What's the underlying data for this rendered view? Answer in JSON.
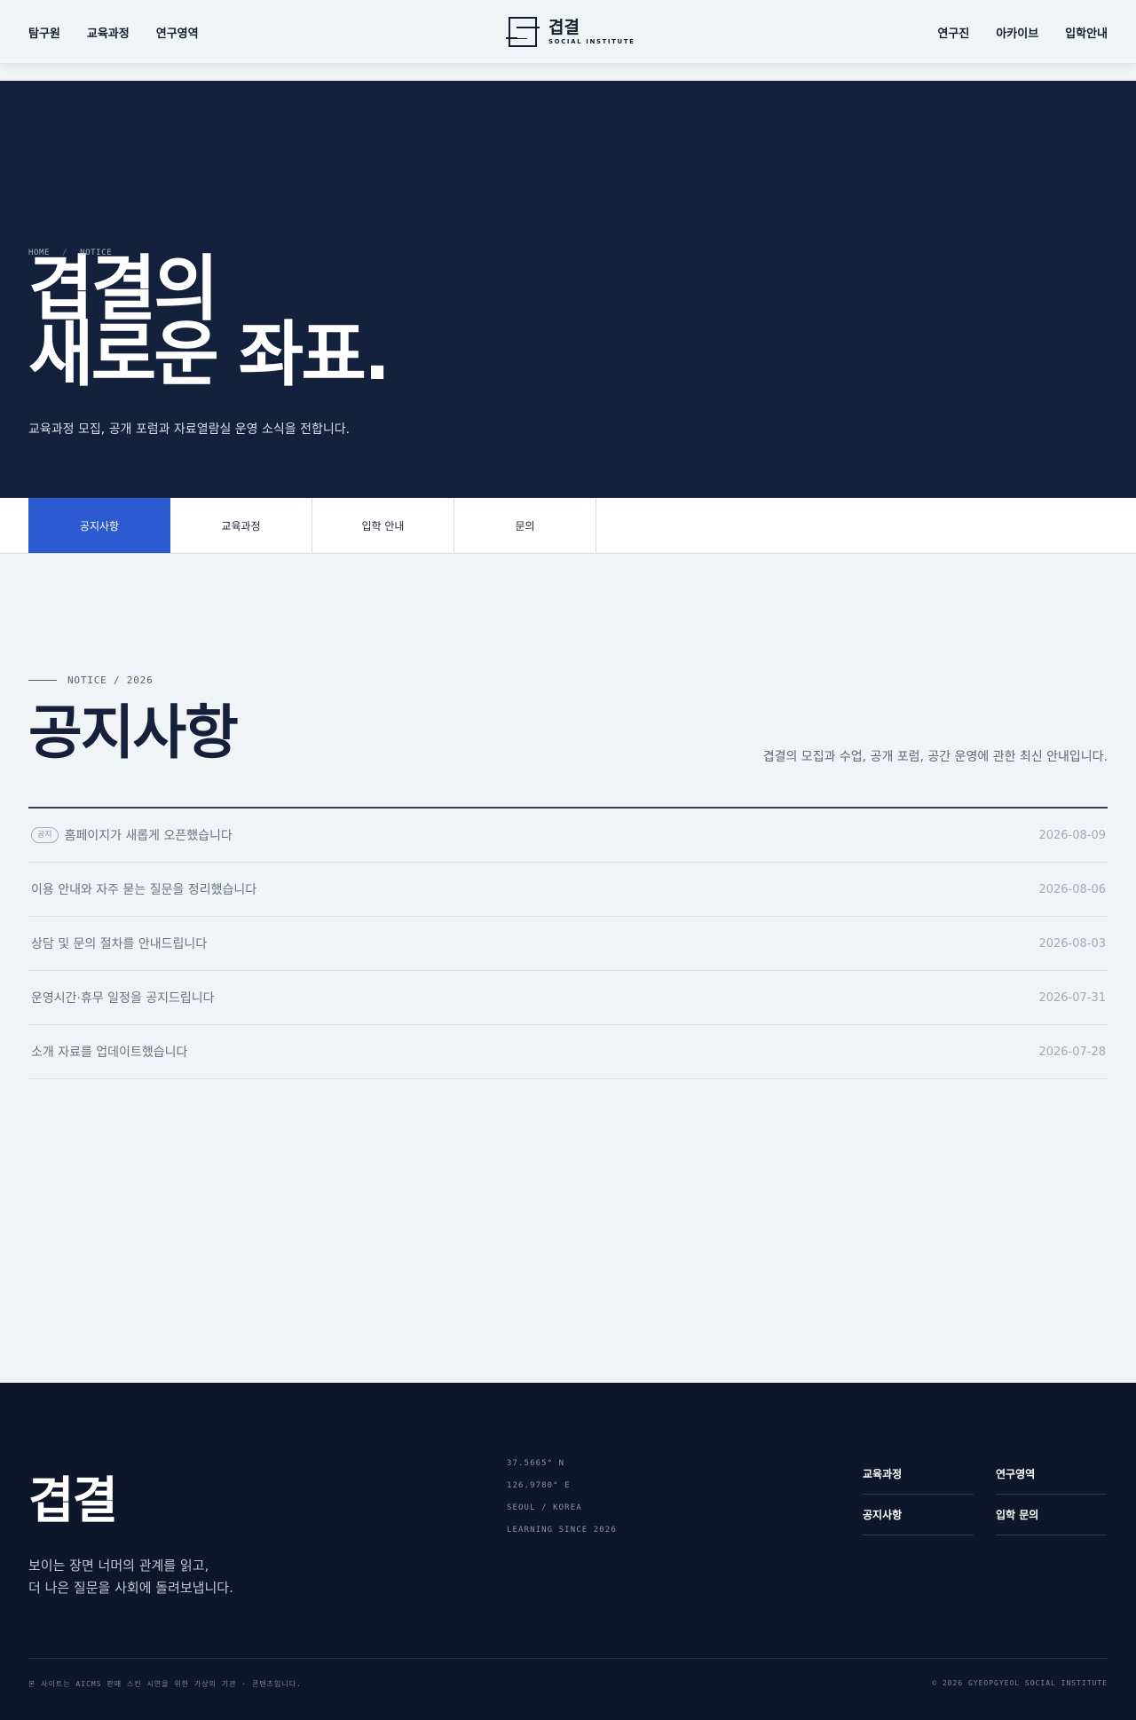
{
  "header": {
    "nav_left": [
      "탐구원",
      "교육과정",
      "연구영역"
    ],
    "nav_right": [
      "연구진",
      "아카이브",
      "입학안내"
    ],
    "logo": {
      "name": "겹결",
      "sub": "SOCIAL INSTITUTE"
    }
  },
  "hero": {
    "breadcrumb": [
      "HOME",
      "NOTICE"
    ],
    "breadcrumb_sep": "/",
    "title_line1": "겹결의",
    "title_line2": "새로운 좌표.",
    "subtitle": "교육과정 모집, 공개 포럼과 자료열람실 운영 소식을 전합니다."
  },
  "tabs": [
    {
      "label": "공지사항",
      "active": true
    },
    {
      "label": "교육과정",
      "active": false
    },
    {
      "label": "입학 안내",
      "active": false
    },
    {
      "label": "문의",
      "active": false
    }
  ],
  "notice": {
    "eyebrow": "NOTICE / 2026",
    "title": "공지사항",
    "description": "겹결의 모집과 수업, 공개 포럼, 공간 운영에 관한 최신 안내입니다.",
    "items": [
      {
        "badge": "공지",
        "title": "홈페이지가 새롭게 오픈했습니다",
        "date": "2026-08-09"
      },
      {
        "badge": "",
        "title": "이용 안내와 자주 묻는 질문을 정리했습니다",
        "date": "2026-08-06"
      },
      {
        "badge": "",
        "title": "상담 및 문의 절차를 안내드립니다",
        "date": "2026-08-03"
      },
      {
        "badge": "",
        "title": "운영시간·휴무 일정을 공지드립니다",
        "date": "2026-07-31"
      },
      {
        "badge": "",
        "title": "소개 자료를 업데이트했습니다",
        "date": "2026-07-28"
      }
    ]
  },
  "footer": {
    "logo": "겹결",
    "desc_line1": "보이는 장면 너머의 관계를 읽고,",
    "desc_line2": "더 나은 질문을 사회에 돌려보냅니다.",
    "coords": [
      "37.5665° N",
      "126.9780° E",
      "SEOUL / KOREA",
      "LEARNING SINCE 2026"
    ],
    "links": [
      "교육과정",
      "연구영역",
      "공지사항",
      "입학 문의"
    ],
    "note": "본 사이트는 AICMS 판매 스킨 시연을 위한 가상의 기관 · 콘텐츠입니다.",
    "copyright": "© 2026 GYEOPGYEOL SOCIAL INSTITUTE"
  },
  "colors": {
    "hero_bg": "#14213d",
    "accent": "#2c5bd1",
    "footer_bg": "#0d1729",
    "page_bg": "#f1f4f6"
  }
}
